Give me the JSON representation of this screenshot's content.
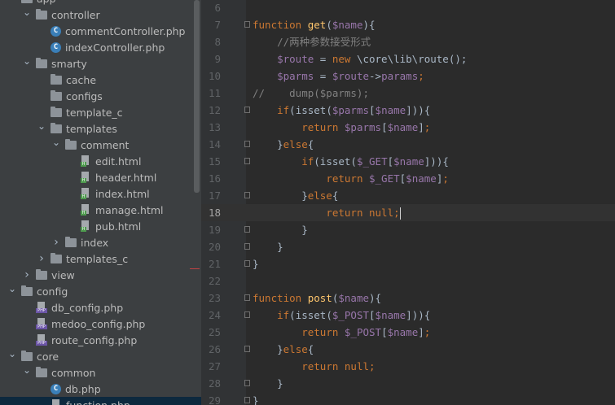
{
  "project_tree": {
    "items": [
      {
        "label": "app",
        "type": "folder",
        "depth": 0,
        "state": "expanded"
      },
      {
        "label": "controller",
        "type": "folder",
        "depth": 1,
        "state": "expanded"
      },
      {
        "label": "commentController.php",
        "type": "php-class",
        "depth": 2
      },
      {
        "label": "indexController.php",
        "type": "php-class",
        "depth": 2
      },
      {
        "label": "smarty",
        "type": "folder",
        "depth": 1,
        "state": "expanded"
      },
      {
        "label": "cache",
        "type": "folder",
        "depth": 2,
        "state": "none"
      },
      {
        "label": "configs",
        "type": "folder",
        "depth": 2,
        "state": "none"
      },
      {
        "label": "template_c",
        "type": "folder",
        "depth": 2,
        "state": "none"
      },
      {
        "label": "templates",
        "type": "folder",
        "depth": 2,
        "state": "expanded"
      },
      {
        "label": "comment",
        "type": "folder",
        "depth": 3,
        "state": "expanded"
      },
      {
        "label": "edit.html",
        "type": "html",
        "depth": 4
      },
      {
        "label": "header.html",
        "type": "html",
        "depth": 4
      },
      {
        "label": "index.html",
        "type": "html",
        "depth": 4
      },
      {
        "label": "manage.html",
        "type": "html",
        "depth": 4
      },
      {
        "label": "pub.html",
        "type": "html",
        "depth": 4
      },
      {
        "label": "index",
        "type": "folder",
        "depth": 3,
        "state": "collapsed"
      },
      {
        "label": "templates_c",
        "type": "folder",
        "depth": 2,
        "state": "collapsed"
      },
      {
        "label": "view",
        "type": "folder",
        "depth": 1,
        "state": "collapsed"
      },
      {
        "label": "config",
        "type": "folder",
        "depth": 0,
        "state": "expanded"
      },
      {
        "label": "db_config.php",
        "type": "php-file",
        "depth": 1
      },
      {
        "label": "medoo_config.php",
        "type": "php-file",
        "depth": 1
      },
      {
        "label": "route_config.php",
        "type": "php-file",
        "depth": 1
      },
      {
        "label": "core",
        "type": "folder",
        "depth": 0,
        "state": "expanded"
      },
      {
        "label": "common",
        "type": "folder",
        "depth": 1,
        "state": "expanded"
      },
      {
        "label": "db.php",
        "type": "php-class",
        "depth": 2
      },
      {
        "label": "function.php",
        "type": "php-file",
        "depth": 2,
        "selected": true
      }
    ]
  },
  "editor": {
    "current_line": 18,
    "lines": [
      {
        "n": "6",
        "fold": false,
        "tokens": []
      },
      {
        "n": "7",
        "fold": true,
        "tokens": [
          [
            "kw",
            "function "
          ],
          [
            "fn",
            "get"
          ],
          [
            "",
            "("
          ],
          [
            "var",
            "$name"
          ],
          [
            "",
            "){"
          ]
        ]
      },
      {
        "n": "8",
        "fold": false,
        "tokens": [
          [
            "",
            "    "
          ],
          [
            "cm",
            "//两种参数接受形式"
          ]
        ]
      },
      {
        "n": "9",
        "fold": false,
        "tokens": [
          [
            "",
            "    "
          ],
          [
            "var",
            "$route"
          ],
          [
            "",
            " = "
          ],
          [
            "kw",
            "new "
          ],
          [
            "",
            "\\core\\lib\\route();"
          ]
        ]
      },
      {
        "n": "10",
        "fold": false,
        "tokens": [
          [
            "",
            "    "
          ],
          [
            "var",
            "$parms"
          ],
          [
            "",
            " = "
          ],
          [
            "var",
            "$route"
          ],
          [
            "",
            "->"
          ],
          [
            "var",
            "params"
          ],
          [
            "kw",
            ";"
          ]
        ]
      },
      {
        "n": "11",
        "fold": false,
        "tokens": [
          [
            "cm",
            "//    dump($parms);"
          ]
        ]
      },
      {
        "n": "12",
        "fold": true,
        "tokens": [
          [
            "",
            "    "
          ],
          [
            "kw",
            "if"
          ],
          [
            "",
            "(isset("
          ],
          [
            "var",
            "$parms"
          ],
          [
            "",
            "["
          ],
          [
            "var",
            "$name"
          ],
          [
            "",
            "])){"
          ]
        ]
      },
      {
        "n": "13",
        "fold": false,
        "tokens": [
          [
            "",
            "        "
          ],
          [
            "kw",
            "return "
          ],
          [
            "var",
            "$parms"
          ],
          [
            "",
            "["
          ],
          [
            "var",
            "$name"
          ],
          [
            "",
            "]"
          ],
          [
            "kw",
            ";"
          ]
        ]
      },
      {
        "n": "14",
        "fold": true,
        "tokens": [
          [
            "",
            "    }"
          ],
          [
            "kw",
            "else"
          ],
          [
            "",
            "{"
          ]
        ]
      },
      {
        "n": "15",
        "fold": true,
        "tokens": [
          [
            "",
            "        "
          ],
          [
            "kw",
            "if"
          ],
          [
            "",
            "(isset("
          ],
          [
            "var",
            "$_GET"
          ],
          [
            "",
            "["
          ],
          [
            "var",
            "$name"
          ],
          [
            "",
            "])){"
          ]
        ]
      },
      {
        "n": "16",
        "fold": false,
        "tokens": [
          [
            "",
            "            "
          ],
          [
            "kw",
            "return "
          ],
          [
            "var",
            "$_GET"
          ],
          [
            "",
            "["
          ],
          [
            "var",
            "$name"
          ],
          [
            "",
            "]"
          ],
          [
            "kw",
            ";"
          ]
        ]
      },
      {
        "n": "17",
        "fold": true,
        "tokens": [
          [
            "",
            "        }"
          ],
          [
            "kw",
            "else"
          ],
          [
            "",
            "{"
          ]
        ]
      },
      {
        "n": "18",
        "fold": false,
        "tokens": [
          [
            "",
            "            "
          ],
          [
            "kw",
            "return null;"
          ]
        ]
      },
      {
        "n": "19",
        "fold": true,
        "tokens": [
          [
            "",
            "        }"
          ]
        ]
      },
      {
        "n": "20",
        "fold": true,
        "tokens": [
          [
            "",
            "    }"
          ]
        ]
      },
      {
        "n": "21",
        "fold": true,
        "tokens": [
          [
            "",
            "}"
          ]
        ]
      },
      {
        "n": "22",
        "fold": false,
        "tokens": []
      },
      {
        "n": "23",
        "fold": true,
        "tokens": [
          [
            "kw",
            "function "
          ],
          [
            "fn",
            "post"
          ],
          [
            "",
            "("
          ],
          [
            "var",
            "$name"
          ],
          [
            "",
            "){"
          ]
        ]
      },
      {
        "n": "24",
        "fold": true,
        "tokens": [
          [
            "",
            "    "
          ],
          [
            "kw",
            "if"
          ],
          [
            "",
            "(isset("
          ],
          [
            "var",
            "$_POST"
          ],
          [
            "",
            "["
          ],
          [
            "var",
            "$name"
          ],
          [
            "",
            "])){"
          ]
        ]
      },
      {
        "n": "25",
        "fold": false,
        "tokens": [
          [
            "",
            "        "
          ],
          [
            "kw",
            "return "
          ],
          [
            "var",
            "$_POST"
          ],
          [
            "",
            "["
          ],
          [
            "var",
            "$name"
          ],
          [
            "",
            "]"
          ],
          [
            "kw",
            ";"
          ]
        ]
      },
      {
        "n": "26",
        "fold": true,
        "tokens": [
          [
            "",
            "    }"
          ],
          [
            "kw",
            "else"
          ],
          [
            "",
            "{"
          ]
        ]
      },
      {
        "n": "27",
        "fold": false,
        "tokens": [
          [
            "",
            "        "
          ],
          [
            "kw",
            "return null;"
          ]
        ]
      },
      {
        "n": "28",
        "fold": true,
        "tokens": [
          [
            "",
            "    }"
          ]
        ]
      },
      {
        "n": "29",
        "fold": true,
        "tokens": [
          [
            "",
            "}"
          ]
        ]
      }
    ]
  },
  "colors": {
    "keyword": "#cc7832",
    "function": "#ffc66d",
    "variable": "#9876aa",
    "comment": "#808080",
    "text": "#a9b7c6",
    "background": "#2b2b2b"
  }
}
